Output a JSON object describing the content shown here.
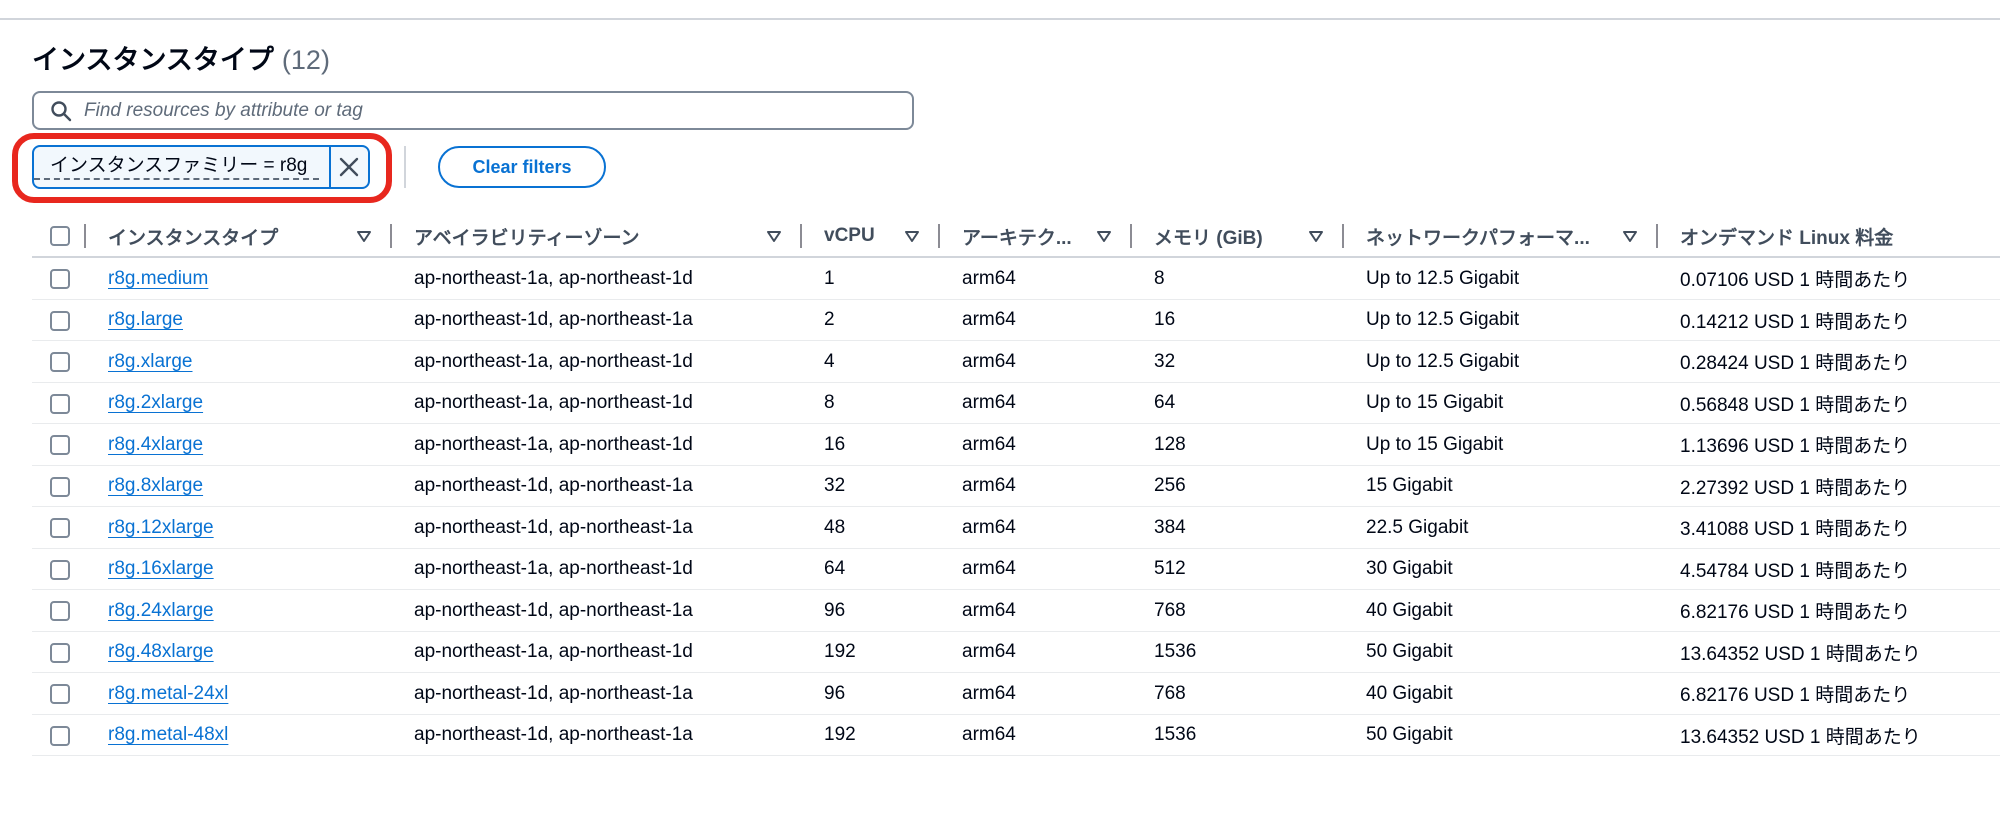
{
  "header": {
    "title": "インスタンスタイプ",
    "count": "(12)"
  },
  "search": {
    "placeholder": "Find resources by attribute or tag"
  },
  "filter": {
    "token_label": "インスタンスファミリー = r8g",
    "clear_label": "Clear filters"
  },
  "columns": {
    "type": "インスタンスタイプ",
    "az": "アベイラビリティーゾーン",
    "vcpu": "vCPU",
    "arch": "アーキテク...",
    "mem": "メモリ (GiB)",
    "net": "ネットワークパフォーマ...",
    "price": "オンデマンド Linux 料金"
  },
  "rows": [
    {
      "type": "r8g.medium",
      "az": "ap-northeast-1a, ap-northeast-1d",
      "vcpu": "1",
      "arch": "arm64",
      "mem": "8",
      "net": "Up to 12.5 Gigabit",
      "price": "0.07106 USD 1 時間あたり"
    },
    {
      "type": "r8g.large",
      "az": "ap-northeast-1d, ap-northeast-1a",
      "vcpu": "2",
      "arch": "arm64",
      "mem": "16",
      "net": "Up to 12.5 Gigabit",
      "price": "0.14212 USD 1 時間あたり"
    },
    {
      "type": "r8g.xlarge",
      "az": "ap-northeast-1a, ap-northeast-1d",
      "vcpu": "4",
      "arch": "arm64",
      "mem": "32",
      "net": "Up to 12.5 Gigabit",
      "price": "0.28424 USD 1 時間あたり"
    },
    {
      "type": "r8g.2xlarge",
      "az": "ap-northeast-1a, ap-northeast-1d",
      "vcpu": "8",
      "arch": "arm64",
      "mem": "64",
      "net": "Up to 15 Gigabit",
      "price": "0.56848 USD 1 時間あたり"
    },
    {
      "type": "r8g.4xlarge",
      "az": "ap-northeast-1a, ap-northeast-1d",
      "vcpu": "16",
      "arch": "arm64",
      "mem": "128",
      "net": "Up to 15 Gigabit",
      "price": "1.13696 USD 1 時間あたり"
    },
    {
      "type": "r8g.8xlarge",
      "az": "ap-northeast-1d, ap-northeast-1a",
      "vcpu": "32",
      "arch": "arm64",
      "mem": "256",
      "net": "15 Gigabit",
      "price": "2.27392 USD 1 時間あたり"
    },
    {
      "type": "r8g.12xlarge",
      "az": "ap-northeast-1d, ap-northeast-1a",
      "vcpu": "48",
      "arch": "arm64",
      "mem": "384",
      "net": "22.5 Gigabit",
      "price": "3.41088 USD 1 時間あたり"
    },
    {
      "type": "r8g.16xlarge",
      "az": "ap-northeast-1a, ap-northeast-1d",
      "vcpu": "64",
      "arch": "arm64",
      "mem": "512",
      "net": "30 Gigabit",
      "price": "4.54784 USD 1 時間あたり"
    },
    {
      "type": "r8g.24xlarge",
      "az": "ap-northeast-1d, ap-northeast-1a",
      "vcpu": "96",
      "arch": "arm64",
      "mem": "768",
      "net": "40 Gigabit",
      "price": "6.82176 USD 1 時間あたり"
    },
    {
      "type": "r8g.48xlarge",
      "az": "ap-northeast-1a, ap-northeast-1d",
      "vcpu": "192",
      "arch": "arm64",
      "mem": "1536",
      "net": "50 Gigabit",
      "price": "13.64352 USD 1 時間あたり"
    },
    {
      "type": "r8g.metal-24xl",
      "az": "ap-northeast-1d, ap-northeast-1a",
      "vcpu": "96",
      "arch": "arm64",
      "mem": "768",
      "net": "40 Gigabit",
      "price": "6.82176 USD 1 時間あたり"
    },
    {
      "type": "r8g.metal-48xl",
      "az": "ap-northeast-1d, ap-northeast-1a",
      "vcpu": "192",
      "arch": "arm64",
      "mem": "1536",
      "net": "50 Gigabit",
      "price": "13.64352 USD 1 時間あたり"
    }
  ],
  "colors": {
    "accent": "#0972d3",
    "highlight": "#e8271e",
    "text": "#000716",
    "muted": "#5f6b7a"
  },
  "icons": {
    "search": "search-icon",
    "close": "close-icon",
    "sort": "sort-down-icon"
  }
}
